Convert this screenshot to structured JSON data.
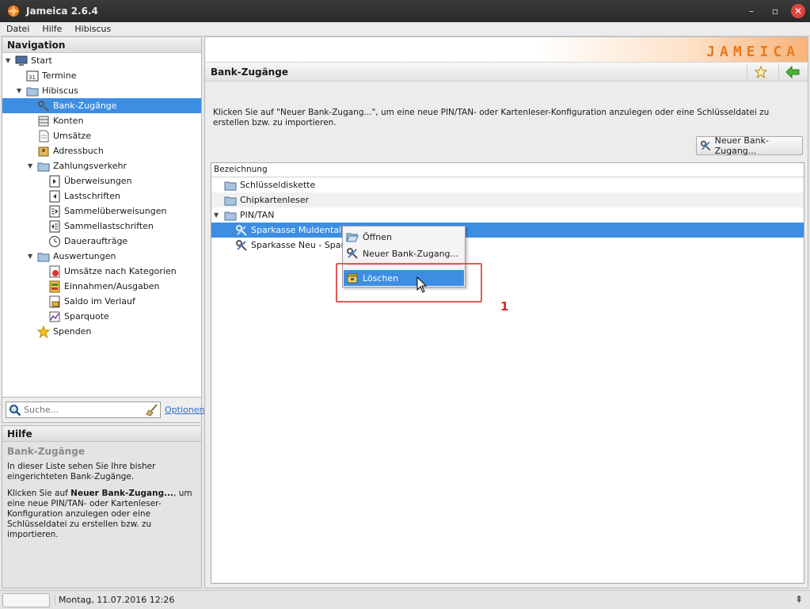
{
  "window": {
    "title": "Jameica 2.6.4",
    "minimize_glyph": "–",
    "restore_glyph": "▫",
    "close_glyph": "✕"
  },
  "menubar": {
    "items": [
      "Datei",
      "Hilfe",
      "Hibiscus"
    ]
  },
  "navigation": {
    "header": "Navigation",
    "items": [
      {
        "label": "Start",
        "icon": "computer-icon",
        "expanded": true
      },
      {
        "label": "Termine",
        "icon": "calendar-icon"
      },
      {
        "label": "Hibiscus",
        "icon": "folder-icon",
        "expanded": true
      },
      {
        "label": "Bank-Zugänge",
        "icon": "key-tools-icon",
        "selected": true
      },
      {
        "label": "Konten",
        "icon": "accounts-icon"
      },
      {
        "label": "Umsätze",
        "icon": "transactions-icon"
      },
      {
        "label": "Adressbuch",
        "icon": "addressbook-icon"
      },
      {
        "label": "Zahlungsverkehr",
        "icon": "folder-icon",
        "expanded": true
      },
      {
        "label": "Überweisungen",
        "icon": "transfer-icon"
      },
      {
        "label": "Lastschriften",
        "icon": "debit-icon"
      },
      {
        "label": "Sammelüberweisungen",
        "icon": "batch-transfer-icon"
      },
      {
        "label": "Sammellastschriften",
        "icon": "batch-debit-icon"
      },
      {
        "label": "Daueraufträge",
        "icon": "clock-icon"
      },
      {
        "label": "Auswertungen",
        "icon": "folder-icon",
        "expanded": true
      },
      {
        "label": "Umsätze nach Kategorien",
        "icon": "category-chart-icon"
      },
      {
        "label": "Einnahmen/Ausgaben",
        "icon": "income-expense-icon"
      },
      {
        "label": "Saldo im Verlauf",
        "icon": "balance-history-icon"
      },
      {
        "label": "Sparquote",
        "icon": "savings-chart-icon"
      },
      {
        "label": "Spenden",
        "icon": "star-icon"
      }
    ]
  },
  "search": {
    "placeholder": "Suche...",
    "options_label": "Optionen"
  },
  "help": {
    "header": "Hilfe",
    "title": "Bank-Zugänge",
    "paragraph1": "In dieser Liste sehen Sie Ihre bisher eingerichteten Bank-Zugänge.",
    "paragraph2_prefix": "Klicken Sie auf ",
    "paragraph2_bold": "Neuer Bank-Zugang...",
    "paragraph2_suffix": ", um eine neue PIN/TAN- oder Kartenleser-Konfiguration anzulegen oder eine Schlüsseldatei zu erstellen bzw. zu importieren."
  },
  "content": {
    "brand": "JAMEICA",
    "view_title": "Bank-Zugänge",
    "intro": "Klicken Sie auf \"Neuer Bank-Zugang...\", um eine neue PIN/TAN- oder Kartenleser-Konfiguration anzulegen oder eine Schlüsseldatei zu erstellen bzw. zu importieren.",
    "new_button_label": "Neuer Bank-Zugang...",
    "table": {
      "column_header": "Bezeichnung",
      "rows": [
        {
          "label": "Schlüsseldiskette",
          "icon": "folder-icon",
          "level": 1
        },
        {
          "label": "Chipkartenleser",
          "icon": "folder-icon",
          "level": 1
        },
        {
          "label": "PIN/TAN",
          "icon": "folder-icon",
          "level": 1,
          "expanded": true
        },
        {
          "label": "Sparkasse Muldental",
          "icon": "key-tools-icon",
          "level": 2,
          "selected": true
        },
        {
          "label": "Sparkasse Neu - Sparkas",
          "icon": "key-tools-icon",
          "level": 2
        }
      ]
    }
  },
  "context_menu": {
    "items": [
      {
        "label": "Öffnen",
        "icon": "folder-open-icon"
      },
      {
        "label": "Neuer Bank-Zugang...",
        "icon": "key-tools-icon"
      },
      {
        "label": "Löschen",
        "icon": "delete-icon",
        "highlighted": true
      }
    ]
  },
  "annotation": {
    "number": "1"
  },
  "statusbar": {
    "datetime": "Montag, 11.07.2016 12:26",
    "arrows_glyph": "⇞"
  },
  "colors": {
    "selection": "#3d8ee3",
    "brand_orange": "#e87a1f",
    "annotation_red": "#e05a5a"
  }
}
